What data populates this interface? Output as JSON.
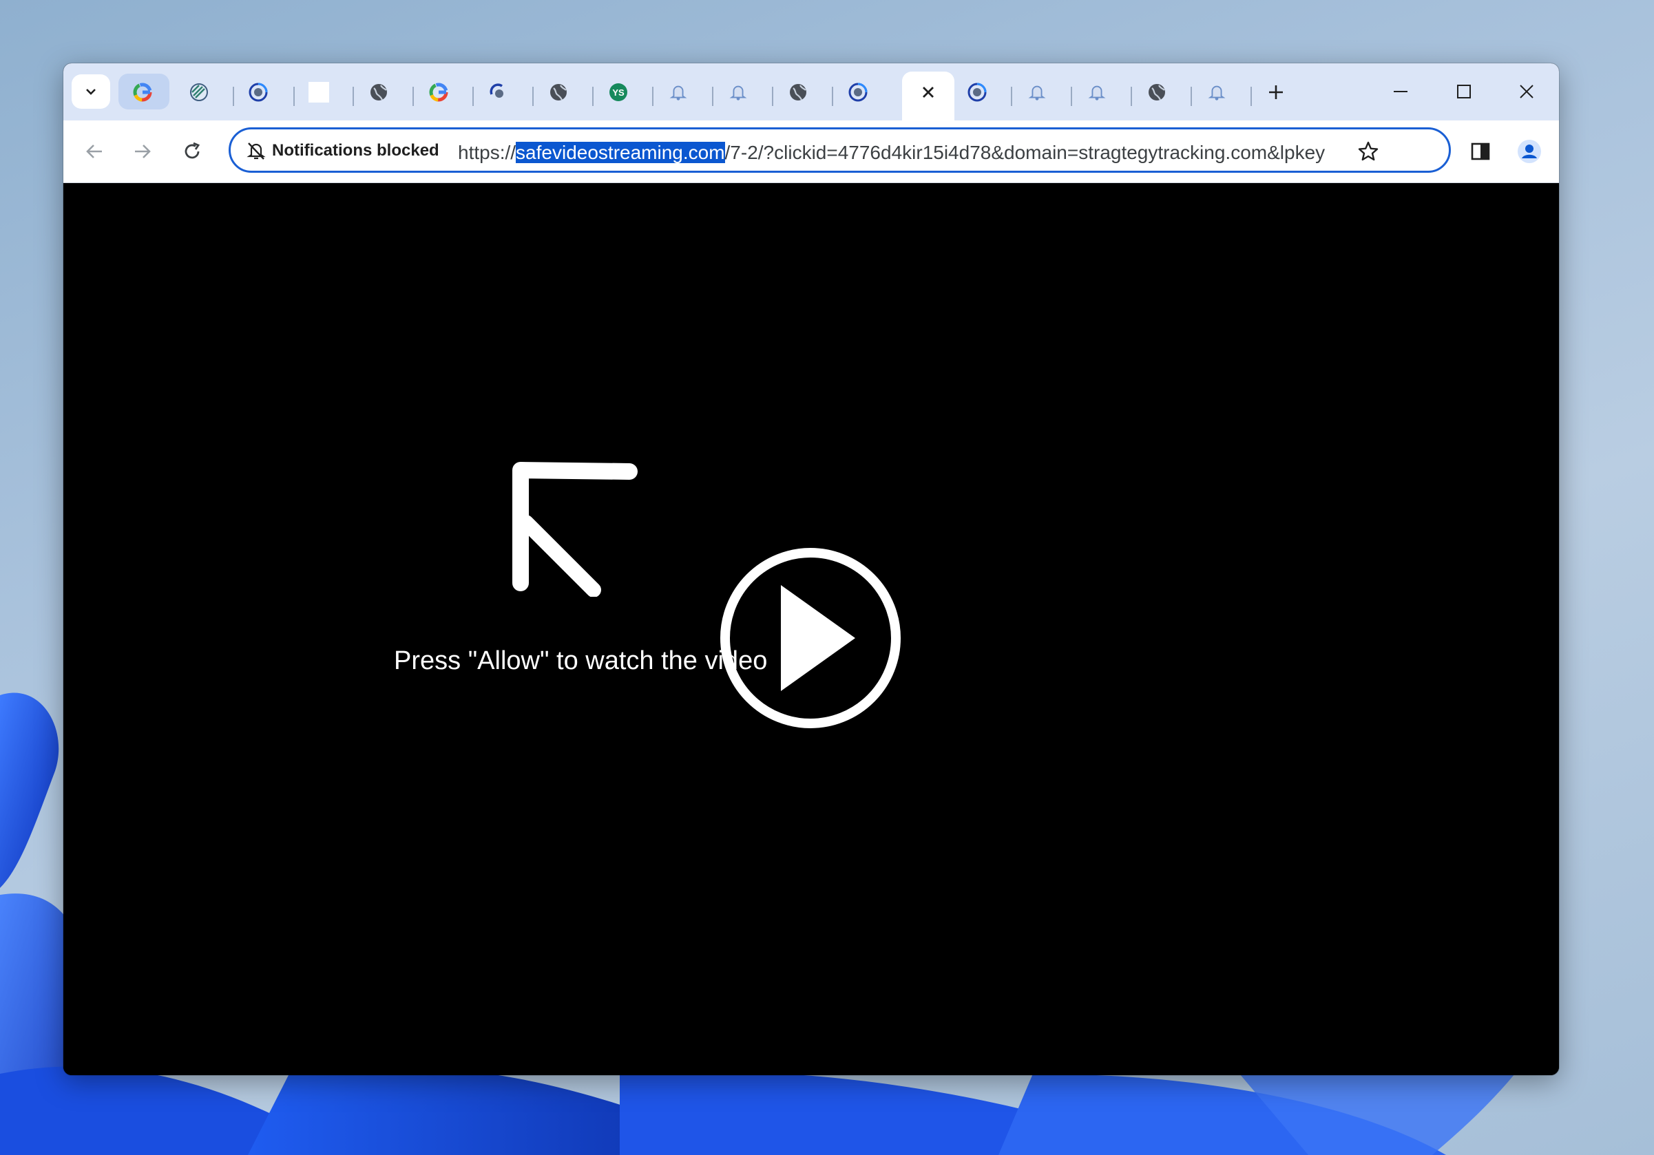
{
  "browser": {
    "tabs": [
      {
        "icon": "google-g-icon",
        "pinned": true
      },
      {
        "icon": "striped-globe-icon"
      },
      {
        "icon": "swirl-icon"
      },
      {
        "icon": "blank-page-icon"
      },
      {
        "icon": "globe-icon"
      },
      {
        "icon": "google-g-icon"
      },
      {
        "icon": "loading-spinner-icon"
      },
      {
        "icon": "globe-icon"
      },
      {
        "icon": "green-badge-icon"
      },
      {
        "icon": "bell-icon"
      },
      {
        "icon": "bell-icon"
      },
      {
        "icon": "globe-icon"
      },
      {
        "icon": "swirl-icon"
      },
      {
        "icon": "close-icon",
        "active": true
      },
      {
        "icon": "swirl-icon"
      },
      {
        "icon": "bell-icon"
      },
      {
        "icon": "bell-icon"
      },
      {
        "icon": "globe-icon"
      },
      {
        "icon": "bell-icon"
      }
    ],
    "new_tab_icon": "plus-icon",
    "window_controls": [
      "minimize-icon",
      "maximize-icon",
      "close-icon"
    ]
  },
  "toolbar": {
    "notification_chip": "Notifications blocked",
    "url_prefix": "https://",
    "url_host": "safevideostreaming.com",
    "url_rest": "/7-2/?clickid=4776d4kir15i4d78&domain=stragtegytracking.com&lpkey",
    "accent_color": "#0b57d0"
  },
  "page": {
    "message": "Press \"Allow\" to watch the video",
    "background": "#000000"
  }
}
